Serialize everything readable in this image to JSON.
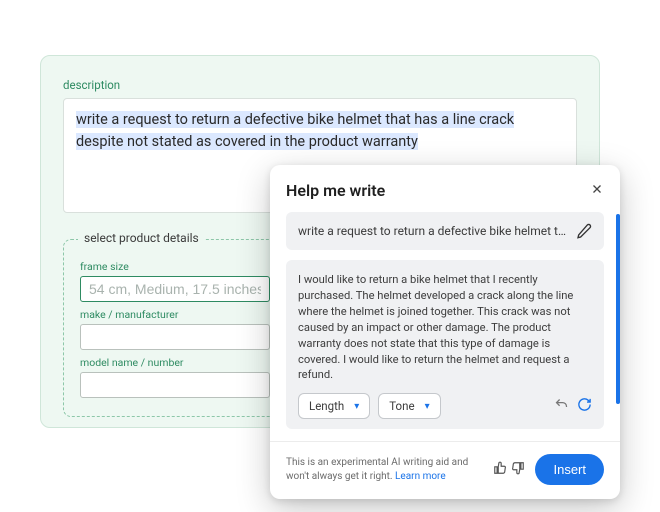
{
  "form": {
    "description_label": "description",
    "description_value": "write a request to return a defective bike helmet that has a line crack despite not stated as covered in the product warranty",
    "details_legend": "select product details",
    "frame_size_label": "frame size",
    "frame_size_placeholder": "54 cm, Medium, 17.5 inches",
    "make_label": "make / manufacturer",
    "make_value": "",
    "model_label": "model name / number",
    "model_value": ""
  },
  "popover": {
    "title": "Help me write",
    "prompt": "write a request to return a defective bike helmet that has a...",
    "result": "I would like to return a bike helmet that I recently purchased. The helmet developed a crack along the line where the helmet is joined together. This crack was not caused by an impact or other damage. The product warranty does not state that this type of damage is covered. I would like to return the helmet and request a refund.",
    "length_label": "Length",
    "tone_label": "Tone",
    "disclaimer": "This is an experimental AI writing aid and won't always get it right. ",
    "learn_more": "Learn more",
    "insert_label": "Insert"
  }
}
